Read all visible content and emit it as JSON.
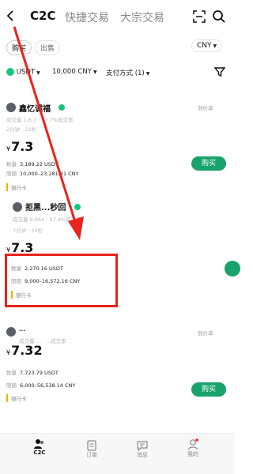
{
  "header": {
    "tabs": [
      {
        "label": "C2C",
        "active": true
      },
      {
        "label": "快捷交易",
        "active": false
      },
      {
        "label": "大宗交易",
        "active": false
      }
    ]
  },
  "trade_tabs": {
    "buy": "购买",
    "sell": "出售"
  },
  "currency_select": "CNY",
  "filters": {
    "coin": "USDT",
    "amount": "10,000 CNY",
    "payment": "支付方式 (1)"
  },
  "listings": [
    {
      "merchant": "鑫忆诚福",
      "stats": "成交量 1,6.7 · 97.7%成交率",
      "pay_time": "2分钟 · 22秒",
      "price_prefix": "¥",
      "price": "7.3",
      "qty_label": "数量",
      "qty": "3,189.22 USDT",
      "limit_label": "限额",
      "limit": "10,000–23,281.31 CNY",
      "payment": "银行卡",
      "side_label": "到价单",
      "buy_label": "购买"
    },
    {
      "merchant": "拒黑...秒回",
      "stats": "成交量 6,664 · 97.4%成交率",
      "pay_time": "7分钟 · 33秒",
      "price_prefix": "¥",
      "price": "7.3",
      "qty_label": "数量",
      "qty": "2,270.16 USDT",
      "limit_label": "限额",
      "limit": "9,000–16,572.16 CNY",
      "payment": "银行卡"
    },
    {
      "merchant": "...",
      "stats": "成交量 ... · ...成交率",
      "pay_time": "...",
      "price_prefix": "¥",
      "price": "7.32",
      "qty_label": "数量",
      "qty": "7,723.79 USDT",
      "limit_label": "限额",
      "limit": "6,000–56,538.14 CNY",
      "payment": "银行卡",
      "side_label": "到价单",
      "buy_label": "购买"
    }
  ],
  "bottom_nav": [
    {
      "label": "C2C",
      "active": true
    },
    {
      "label": "订单",
      "active": false
    },
    {
      "label": "消息",
      "active": false
    },
    {
      "label": "我的",
      "active": false
    }
  ],
  "annotation": {
    "color": "#e8241d"
  },
  "colors": {
    "buy_green": "#19a36b",
    "verified_green": "#19c37d",
    "accent_red": "#e8241d"
  }
}
